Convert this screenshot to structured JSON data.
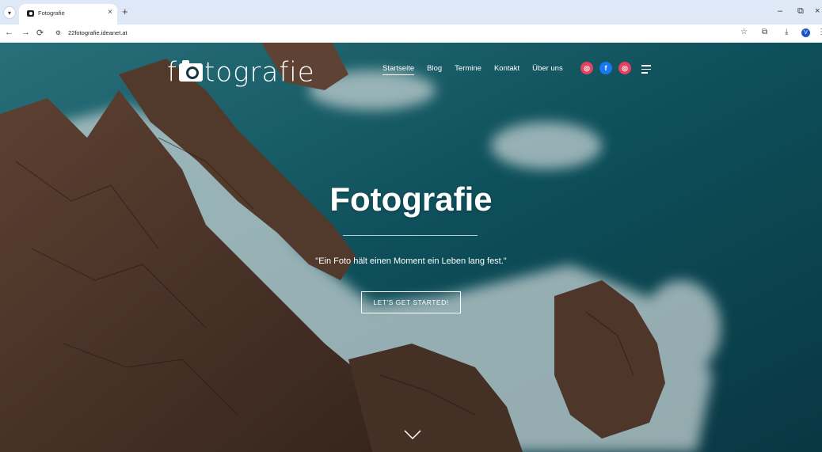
{
  "browser": {
    "tab_title": "Fotografie",
    "tab_close": "×",
    "new_tab": "+",
    "url": "22fotografie.ideanet.at",
    "profile_initial": "V",
    "window_controls": {
      "minimize": "–",
      "restore": "⧉",
      "close": "×"
    },
    "icons": [
      "tab-list-icon",
      "back-icon",
      "forward-icon",
      "reload-icon",
      "site-settings-icon",
      "star-icon",
      "extensions-icon",
      "download-icon",
      "menu-icon"
    ]
  },
  "site": {
    "logo_text": "tografie",
    "logo_prefix": "f",
    "nav": [
      {
        "label": "Startseite",
        "active": true
      },
      {
        "label": "Blog"
      },
      {
        "label": "Termine"
      },
      {
        "label": "Kontakt"
      },
      {
        "label": "Über uns"
      }
    ],
    "social": [
      {
        "name": "instagram-icon",
        "color": "#e4405f"
      },
      {
        "name": "facebook-icon",
        "color": "#1877f2"
      },
      {
        "name": "instagram-icon",
        "color": "#e4405f"
      }
    ],
    "hero": {
      "title": "Fotografie",
      "subtitle": "\"Ein Foto hält einen Moment ein Leben lang fest.\"",
      "cta": "LET'S GET STARTED!"
    }
  }
}
